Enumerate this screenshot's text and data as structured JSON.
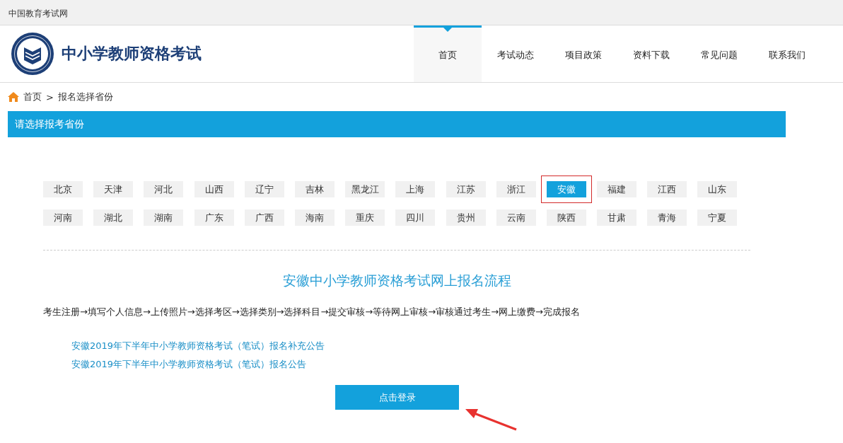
{
  "top_bar": {
    "site_name": "中国教育考试网"
  },
  "header": {
    "title": "中小学教师资格考试"
  },
  "nav": [
    {
      "label": "首页",
      "selected": true
    },
    {
      "label": "考试动态",
      "selected": false
    },
    {
      "label": "项目政策",
      "selected": false
    },
    {
      "label": "资料下载",
      "selected": false
    },
    {
      "label": "常见问题",
      "selected": false
    },
    {
      "label": "联系我们",
      "selected": false
    }
  ],
  "breadcrumb": {
    "home": "首页",
    "separator": ">",
    "current": "报名选择省份"
  },
  "section_title": "请选择报考省份",
  "provinces": [
    {
      "name": "北京",
      "selected": false
    },
    {
      "name": "天津",
      "selected": false
    },
    {
      "name": "河北",
      "selected": false
    },
    {
      "name": "山西",
      "selected": false
    },
    {
      "name": "辽宁",
      "selected": false
    },
    {
      "name": "吉林",
      "selected": false
    },
    {
      "name": "黑龙江",
      "selected": false
    },
    {
      "name": "上海",
      "selected": false
    },
    {
      "name": "江苏",
      "selected": false
    },
    {
      "name": "浙江",
      "selected": false
    },
    {
      "name": "安徽",
      "selected": true
    },
    {
      "name": "福建",
      "selected": false
    },
    {
      "name": "江西",
      "selected": false
    },
    {
      "name": "山东",
      "selected": false
    },
    {
      "name": "河南",
      "selected": false
    },
    {
      "name": "湖北",
      "selected": false
    },
    {
      "name": "湖南",
      "selected": false
    },
    {
      "name": "广东",
      "selected": false
    },
    {
      "name": "广西",
      "selected": false
    },
    {
      "name": "海南",
      "selected": false
    },
    {
      "name": "重庆",
      "selected": false
    },
    {
      "name": "四川",
      "selected": false
    },
    {
      "name": "贵州",
      "selected": false
    },
    {
      "name": "云南",
      "selected": false
    },
    {
      "name": "陕西",
      "selected": false
    },
    {
      "name": "甘肃",
      "selected": false
    },
    {
      "name": "青海",
      "selected": false
    },
    {
      "name": "宁夏",
      "selected": false
    }
  ],
  "process_title": "安徽中小学教师资格考试网上报名流程",
  "process_steps": "考生注册→填写个人信息→上传照片→选择考区→选择类别→选择科目→提交审核→等待网上审核→审核通过考生→网上缴费→完成报名",
  "notices": [
    "安徽2019年下半年中小学教师资格考试（笔试）报名补充公告",
    "安徽2019年下半年中小学教师资格考试（笔试）报名公告"
  ],
  "login_button": "点击登录"
}
